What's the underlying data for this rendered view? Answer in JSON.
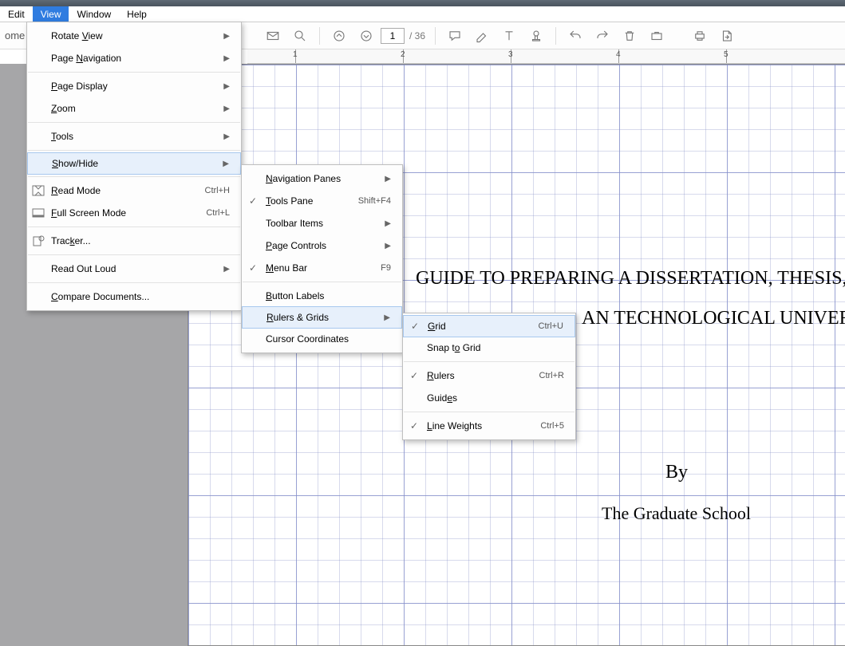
{
  "menubar": {
    "edit": "Edit",
    "view": "View",
    "window": "Window",
    "help": "Help"
  },
  "toolbar": {
    "home": "ome",
    "page_current": "1",
    "page_total": "/ 36"
  },
  "ruler": {
    "r1": "1",
    "r2": "2",
    "r3": "3",
    "r4": "4",
    "r5": "5"
  },
  "document": {
    "line1": "GUIDE TO PREPARING A DISSERTATION, THESIS, O",
    "line2": "AN TECHNOLOGICAL UNIVERS",
    "line3": "By",
    "line4": "The Graduate School"
  },
  "view_menu": {
    "rotate_view": "Rotate View",
    "page_nav": "Page Navigation",
    "page_display": "Page Display",
    "zoom": "Zoom",
    "tools": "Tools",
    "show_hide": "Show/Hide",
    "read_mode": "Read Mode",
    "sc_read": "Ctrl+H",
    "full_screen": "Full Screen Mode",
    "sc_full": "Ctrl+L",
    "tracker": "Tracker...",
    "read_out_loud": "Read Out Loud",
    "compare": "Compare Documents..."
  },
  "show_hide_menu": {
    "nav_panes": "Navigation Panes",
    "tools_pane": "Tools Pane",
    "sc_tools": "Shift+F4",
    "toolbar_items": "Toolbar Items",
    "page_controls": "Page Controls",
    "menu_bar": "Menu Bar",
    "sc_menubar": "F9",
    "button_labels": "Button Labels",
    "rulers_grids": "Rulers & Grids",
    "cursor_coords": "Cursor Coordinates"
  },
  "rulers_menu": {
    "grid": "Grid",
    "sc_grid": "Ctrl+U",
    "snap": "Snap to Grid",
    "rulers": "Rulers",
    "sc_rulers": "Ctrl+R",
    "guides": "Guides",
    "line_weights": "Line Weights",
    "sc_lw": "Ctrl+5"
  }
}
